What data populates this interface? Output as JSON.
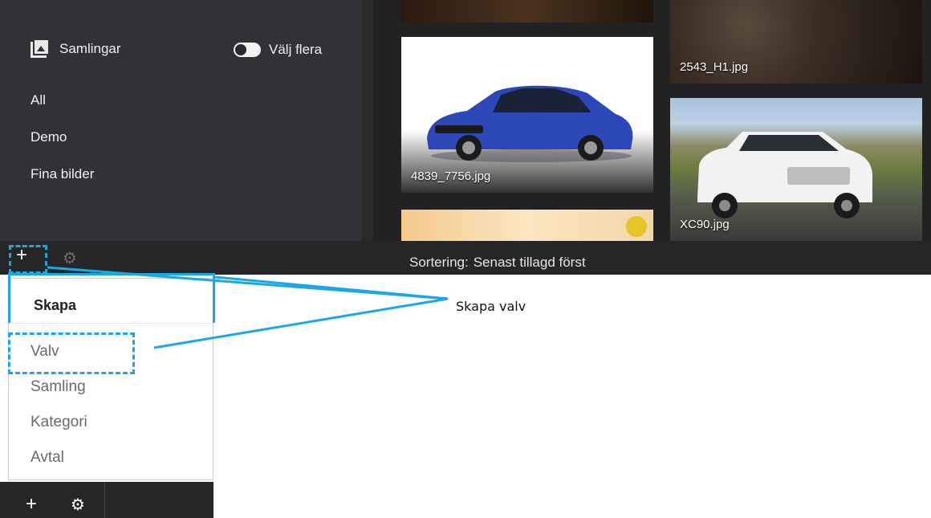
{
  "sidebar": {
    "collections_title": "Samlingar",
    "select_many_label": "Välj flera",
    "collections": [
      "All",
      "Demo",
      "Fina bilder"
    ]
  },
  "gallery": {
    "images": [
      {
        "name": "2543_H1.jpg"
      },
      {
        "name": "4839_7756.jpg"
      },
      {
        "name": "XC90.jpg"
      }
    ]
  },
  "toolbar": {
    "add_icon": "plus-icon",
    "settings_icon": "gear-icon",
    "sort_label": "Sortering:",
    "sort_value": "Senast tillagd först"
  },
  "create_menu": {
    "heading": "Skapa",
    "items": [
      "Valv",
      "Samling",
      "Kategori",
      "Avtal"
    ]
  },
  "callout": {
    "text": "Skapa valv",
    "color": "#1ba7e4"
  },
  "colors": {
    "dark_bg": "#2a2a2d",
    "sidebar_bg": "#323236",
    "accent": "#1ba7e4"
  }
}
